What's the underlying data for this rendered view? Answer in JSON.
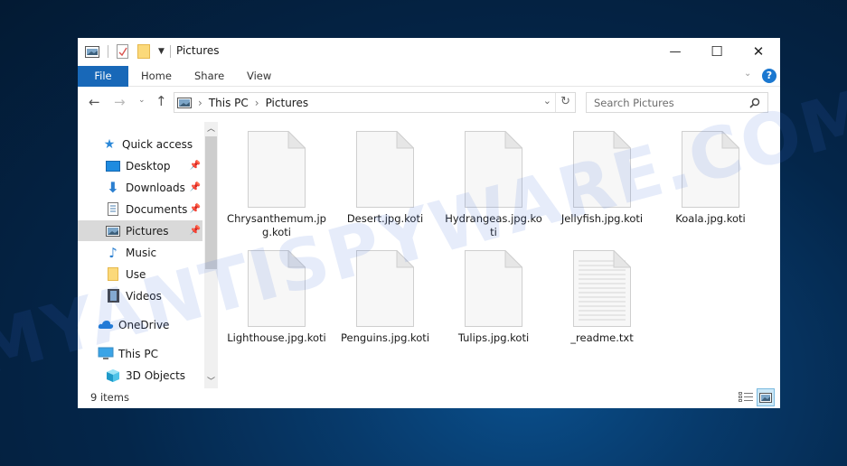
{
  "window": {
    "title": "Pictures",
    "controls": {
      "minimize": "—",
      "maximize": "☐",
      "close": "✕"
    }
  },
  "ribbon": {
    "tabs": [
      {
        "label": "File",
        "active": true
      },
      {
        "label": "Home"
      },
      {
        "label": "Share"
      },
      {
        "label": "View"
      }
    ],
    "help_icon": "?",
    "expand_icon": "chevron-down-icon"
  },
  "navigation": {
    "breadcrumb": [
      "This PC",
      "Pictures"
    ],
    "separator": "›",
    "search_placeholder": "Search Pictures"
  },
  "sidebar": {
    "items": [
      {
        "label": "Quick access",
        "icon": "star-icon",
        "indent": 0
      },
      {
        "label": "Desktop",
        "icon": "desktop-icon",
        "indent": 1,
        "pinned": true
      },
      {
        "label": "Downloads",
        "icon": "download-icon",
        "indent": 1,
        "pinned": true
      },
      {
        "label": "Documents",
        "icon": "documents-icon",
        "indent": 1,
        "pinned": true
      },
      {
        "label": "Pictures",
        "icon": "pictures-icon",
        "indent": 1,
        "pinned": true,
        "selected": true
      },
      {
        "label": "Music",
        "icon": "music-icon",
        "indent": 1
      },
      {
        "label": "Use",
        "icon": "folder-icon",
        "indent": 1
      },
      {
        "label": "Videos",
        "icon": "videos-icon",
        "indent": 1
      },
      {
        "label": "OneDrive",
        "icon": "onedrive-icon",
        "indent": 0
      },
      {
        "label": "This PC",
        "icon": "this-pc-icon",
        "indent": 0
      },
      {
        "label": "3D Objects",
        "icon": "3d-objects-icon",
        "indent": 1
      }
    ]
  },
  "files": [
    {
      "name": "Chrysanthemum.jpg.koti",
      "type": "blank"
    },
    {
      "name": "Desert.jpg.koti",
      "type": "blank"
    },
    {
      "name": "Hydrangeas.jpg.koti",
      "type": "blank"
    },
    {
      "name": "Jellyfish.jpg.koti",
      "type": "blank"
    },
    {
      "name": "Koala.jpg.koti",
      "type": "blank"
    },
    {
      "name": "Lighthouse.jpg.koti",
      "type": "blank"
    },
    {
      "name": "Penguins.jpg.koti",
      "type": "blank"
    },
    {
      "name": "Tulips.jpg.koti",
      "type": "blank"
    },
    {
      "name": "_readme.txt",
      "type": "text"
    }
  ],
  "status": {
    "item_count": "9 items"
  },
  "watermark": "MYANTISPYWARE.COM",
  "colors": {
    "accent": "#1868b8",
    "desktop_bg": "#04264a",
    "selected_bg": "#d9d9d9"
  }
}
